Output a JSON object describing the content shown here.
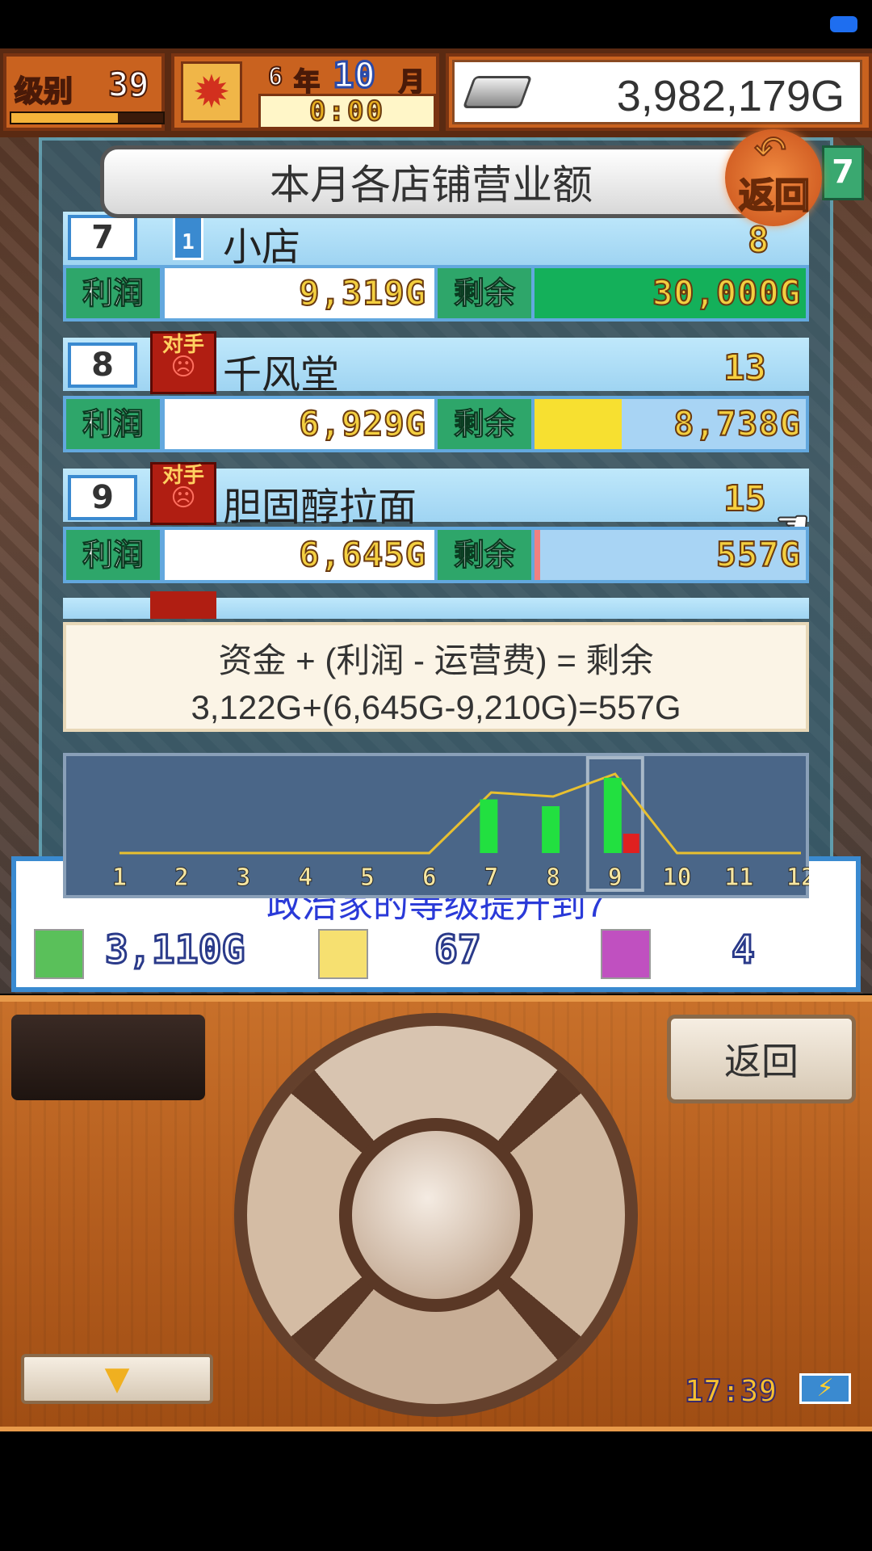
{
  "hud": {
    "level_label": "级别",
    "level": "39",
    "level_progress": 0.7,
    "year": "6",
    "year_unit": "年",
    "month": "10",
    "month_unit": "月",
    "clock": "0:00",
    "money": "3,982,179G"
  },
  "modal": {
    "title": "本月各店铺营业额",
    "back_label": "返回",
    "side_tab": "7"
  },
  "labels": {
    "profit": "利润",
    "remaining": "剩余",
    "rival_badge": "对手"
  },
  "rows": [
    {
      "rank": "7",
      "sub_rank": "1",
      "name": "小店",
      "score": "8",
      "rival": false,
      "profit": "9,319G",
      "remaining": "30,000G",
      "remaining_fill": 1.0,
      "fill_color": "#14b05a"
    },
    {
      "rank": "8",
      "name": "千风堂",
      "score": "13",
      "rival": true,
      "profit": "6,929G",
      "remaining": "8,738G",
      "remaining_fill": 0.32,
      "fill_color": "#f7e030"
    },
    {
      "rank": "9",
      "name": "胆固醇拉面",
      "score": "15",
      "rival": true,
      "profit": "6,645G",
      "remaining": "557G",
      "remaining_fill": 0.02,
      "fill_color": "#f08080"
    }
  ],
  "formula": {
    "line1": "资金 + (利润 - 运营费) = 剩余",
    "line2": "3,122G+(6,645G-9,210G)=557G"
  },
  "chart_data": {
    "type": "bar",
    "categories": [
      "1",
      "2",
      "3",
      "4",
      "5",
      "6",
      "7",
      "8",
      "9",
      "10",
      "11",
      "12"
    ],
    "series": [
      {
        "values": [
          0,
          0,
          0,
          0,
          0,
          0,
          6645,
          5800,
          9319,
          0,
          0,
          0
        ],
        "color": "#22e040"
      },
      {
        "values": [
          0,
          0,
          0,
          0,
          0,
          0,
          0,
          0,
          2400,
          0,
          0,
          0
        ],
        "color": "#e02020"
      }
    ],
    "line": {
      "values": [
        0,
        0,
        0,
        0,
        0,
        0,
        7500,
        7000,
        9800,
        0,
        0,
        0
      ],
      "color": "#e8c030"
    },
    "highlight_category": "9"
  },
  "bottom_strip": {
    "message": "政治家的等级提升到7",
    "stats": [
      {
        "icon": "money-bag-icon",
        "value": "3,110G"
      },
      {
        "icon": "spoon-icon",
        "value": "67"
      },
      {
        "icon": "rival-face-icon",
        "value": "4"
      }
    ]
  },
  "controller": {
    "back_label": "返回",
    "down_glyph": "▼"
  },
  "status": {
    "time": "17:39",
    "battery_glyph": "⚡"
  }
}
